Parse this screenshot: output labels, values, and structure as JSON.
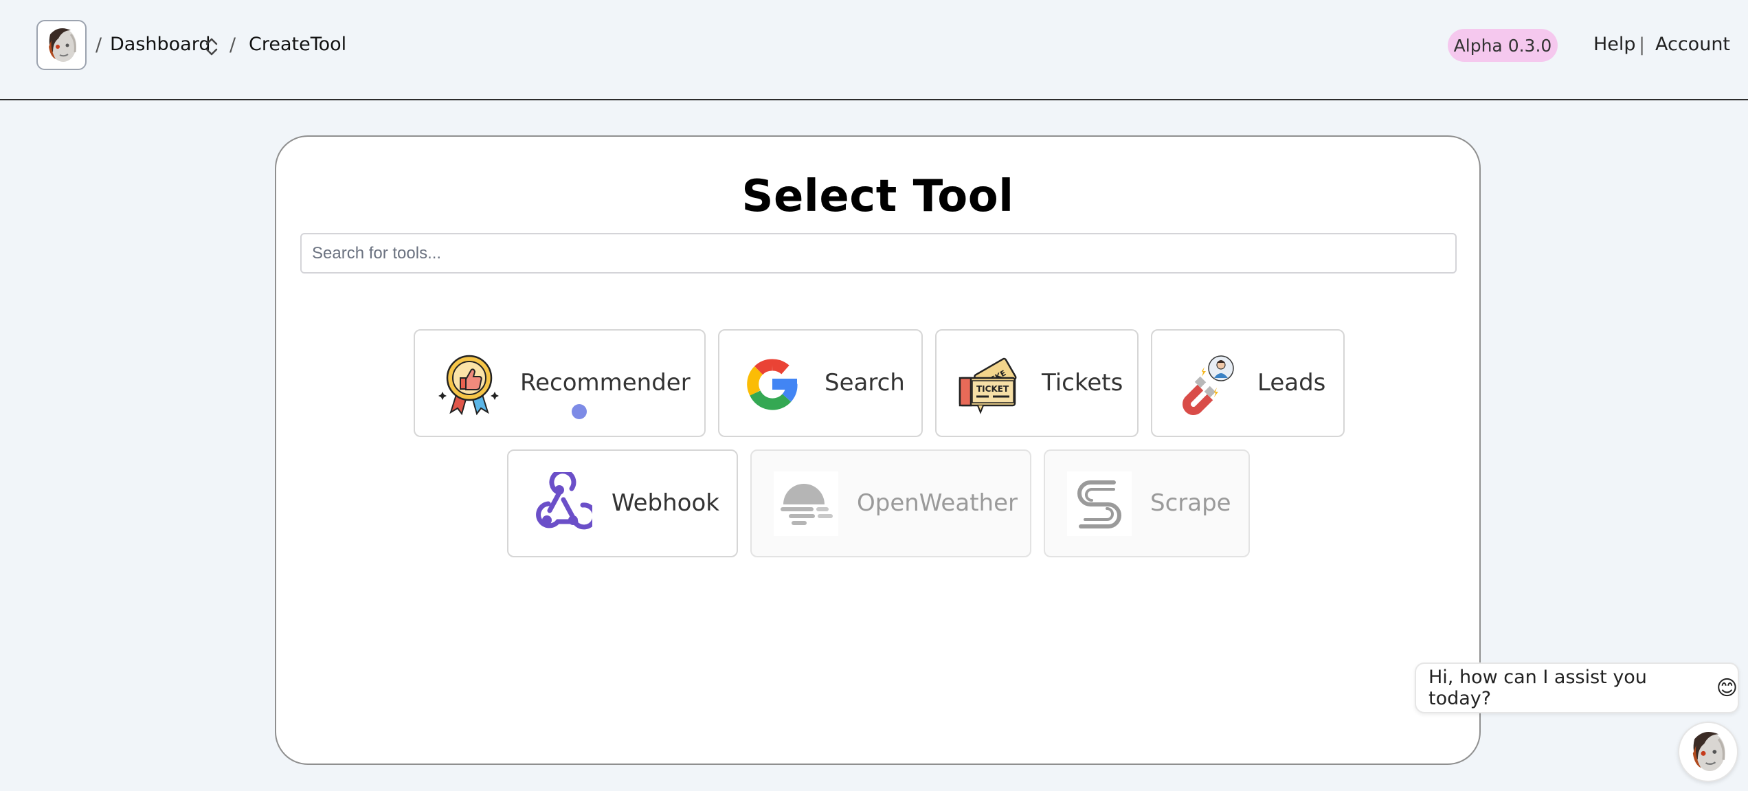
{
  "header": {
    "logo_icon": "robot-face-avatar-icon",
    "breadcrumb": {
      "separator": "/",
      "items": [
        {
          "label": "Dashboard",
          "icon": "chevron-up-down-icon"
        },
        {
          "label": "CreateTool"
        }
      ]
    },
    "version_badge": "Alpha 0.3.0",
    "version_badge_color": "#f5c8ee",
    "links": {
      "help": "Help",
      "divider": "|",
      "account": "Account"
    }
  },
  "main": {
    "title": "Select Tool",
    "search": {
      "placeholder": "Search for tools...",
      "value": ""
    },
    "tools": [
      {
        "label": "Recommender",
        "icon": "award-thumbs-up-icon",
        "enabled": true
      },
      {
        "label": "Search",
        "icon": "google-g-icon",
        "enabled": true
      },
      {
        "label": "Tickets",
        "icon": "ticket-icon",
        "enabled": true
      },
      {
        "label": "Leads",
        "icon": "magnet-person-icon",
        "enabled": true
      },
      {
        "label": "Webhook",
        "icon": "webhook-icon",
        "enabled": true
      },
      {
        "label": "OpenWeather",
        "icon": "weather-fog-icon",
        "enabled": false
      },
      {
        "label": "Scrape",
        "icon": "scrape-s-icon",
        "enabled": false
      }
    ]
  },
  "chat": {
    "message": "Hi, how can I assist you today?",
    "emoji": "😊",
    "avatar_icon": "robot-face-avatar-icon"
  },
  "colors": {
    "page_bg": "#f1f5f9",
    "accent_dot": "#7d8be6",
    "webhook_purple": "#6b4fc8"
  }
}
